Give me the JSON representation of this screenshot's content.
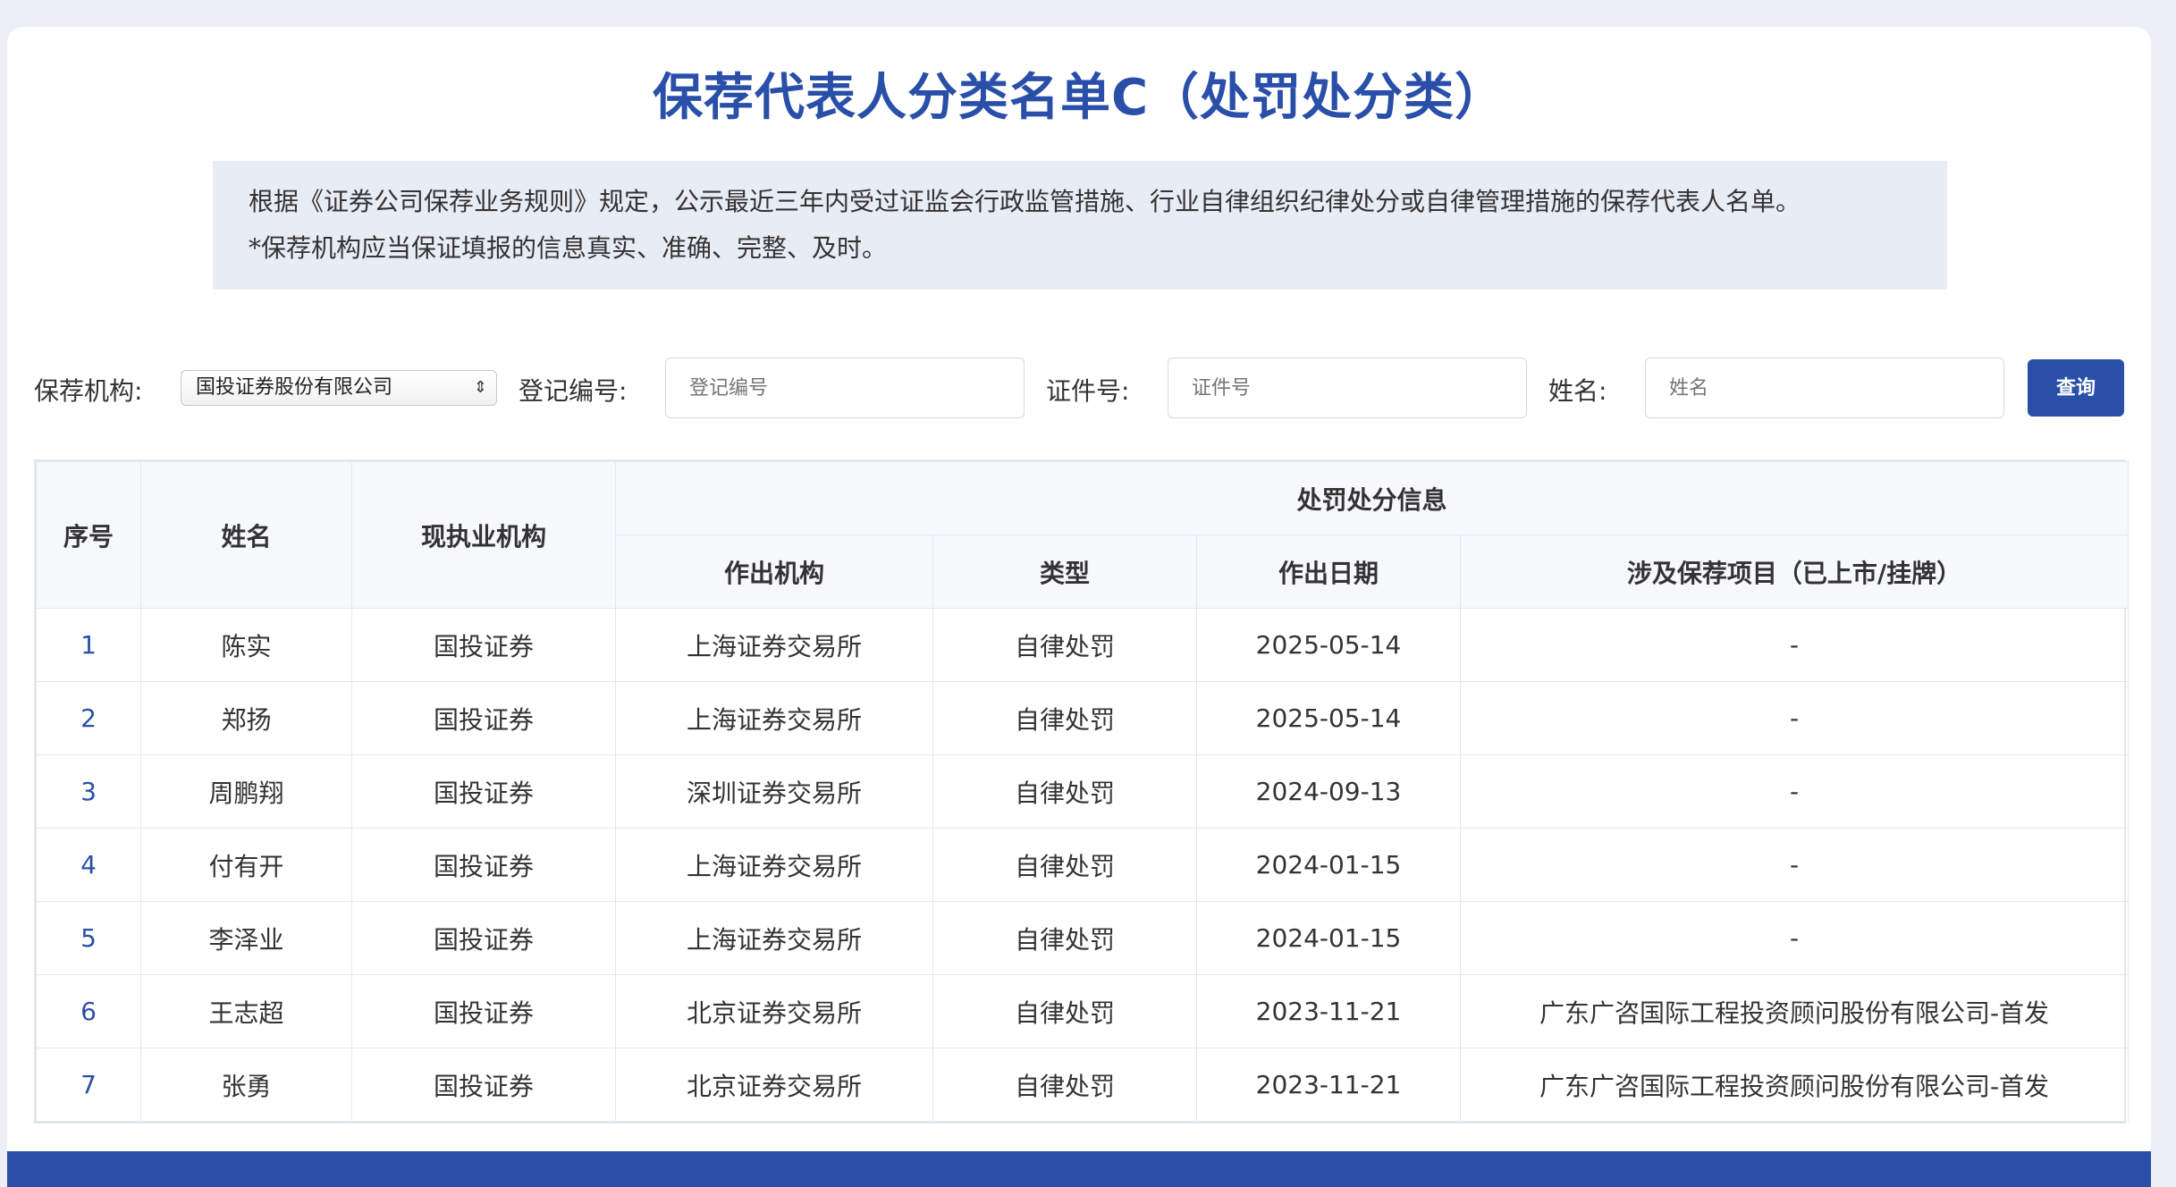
{
  "title": "保荐代表人分类名单C（处罚处分类）",
  "notice": {
    "line1": "根据《证券公司保荐业务规则》规定，公示最近三年内受过证监会行政监管措施、行业自律组织纪律处分或自律管理措施的保荐代表人名单。",
    "line2": "*保荐机构应当保证填报的信息真实、准确、完整、及时。"
  },
  "filters": {
    "institution_label": "保荐机构:",
    "institution_value": "国投证券股份有限公司",
    "reg_no_label": "登记编号:",
    "reg_no_placeholder": "登记编号",
    "cert_no_label": "证件号:",
    "cert_no_placeholder": "证件号",
    "name_label": "姓名:",
    "name_placeholder": "姓名",
    "query_label": "查询"
  },
  "table": {
    "headers": {
      "index": "序号",
      "name": "姓名",
      "current_institution": "现执业机构",
      "penalty_group": "处罚处分信息",
      "issuer": "作出机构",
      "type": "类型",
      "date": "作出日期",
      "project": "涉及保荐项目（已上市/挂牌）"
    },
    "rows": [
      {
        "index": "1",
        "name": "陈实",
        "institution": "国投证券",
        "issuer": "上海证券交易所",
        "type": "自律处罚",
        "date": "2025-05-14",
        "project": "-"
      },
      {
        "index": "2",
        "name": "郑扬",
        "institution": "国投证券",
        "issuer": "上海证券交易所",
        "type": "自律处罚",
        "date": "2025-05-14",
        "project": "-"
      },
      {
        "index": "3",
        "name": "周鹏翔",
        "institution": "国投证券",
        "issuer": "深圳证券交易所",
        "type": "自律处罚",
        "date": "2024-09-13",
        "project": "-"
      },
      {
        "index": "4",
        "name": "付有开",
        "institution": "国投证券",
        "issuer": "上海证券交易所",
        "type": "自律处罚",
        "date": "2024-01-15",
        "project": "-"
      },
      {
        "index": "5",
        "name": "李泽业",
        "institution": "国投证券",
        "issuer": "上海证券交易所",
        "type": "自律处罚",
        "date": "2024-01-15",
        "project": "-"
      },
      {
        "index": "6",
        "name": "王志超",
        "institution": "国投证券",
        "issuer": "北京证券交易所",
        "type": "自律处罚",
        "date": "2023-11-21",
        "project": "广东广咨国际工程投资顾问股份有限公司-首发"
      },
      {
        "index": "7",
        "name": "张勇",
        "institution": "国投证券",
        "issuer": "北京证券交易所",
        "type": "自律处罚",
        "date": "2023-11-21",
        "project": "广东广咨国际工程投资顾问股份有限公司-首发"
      }
    ]
  },
  "colors": {
    "accent": "#2a4fa8",
    "background": "#eceff5",
    "notice_bg": "#e8ecf5"
  }
}
